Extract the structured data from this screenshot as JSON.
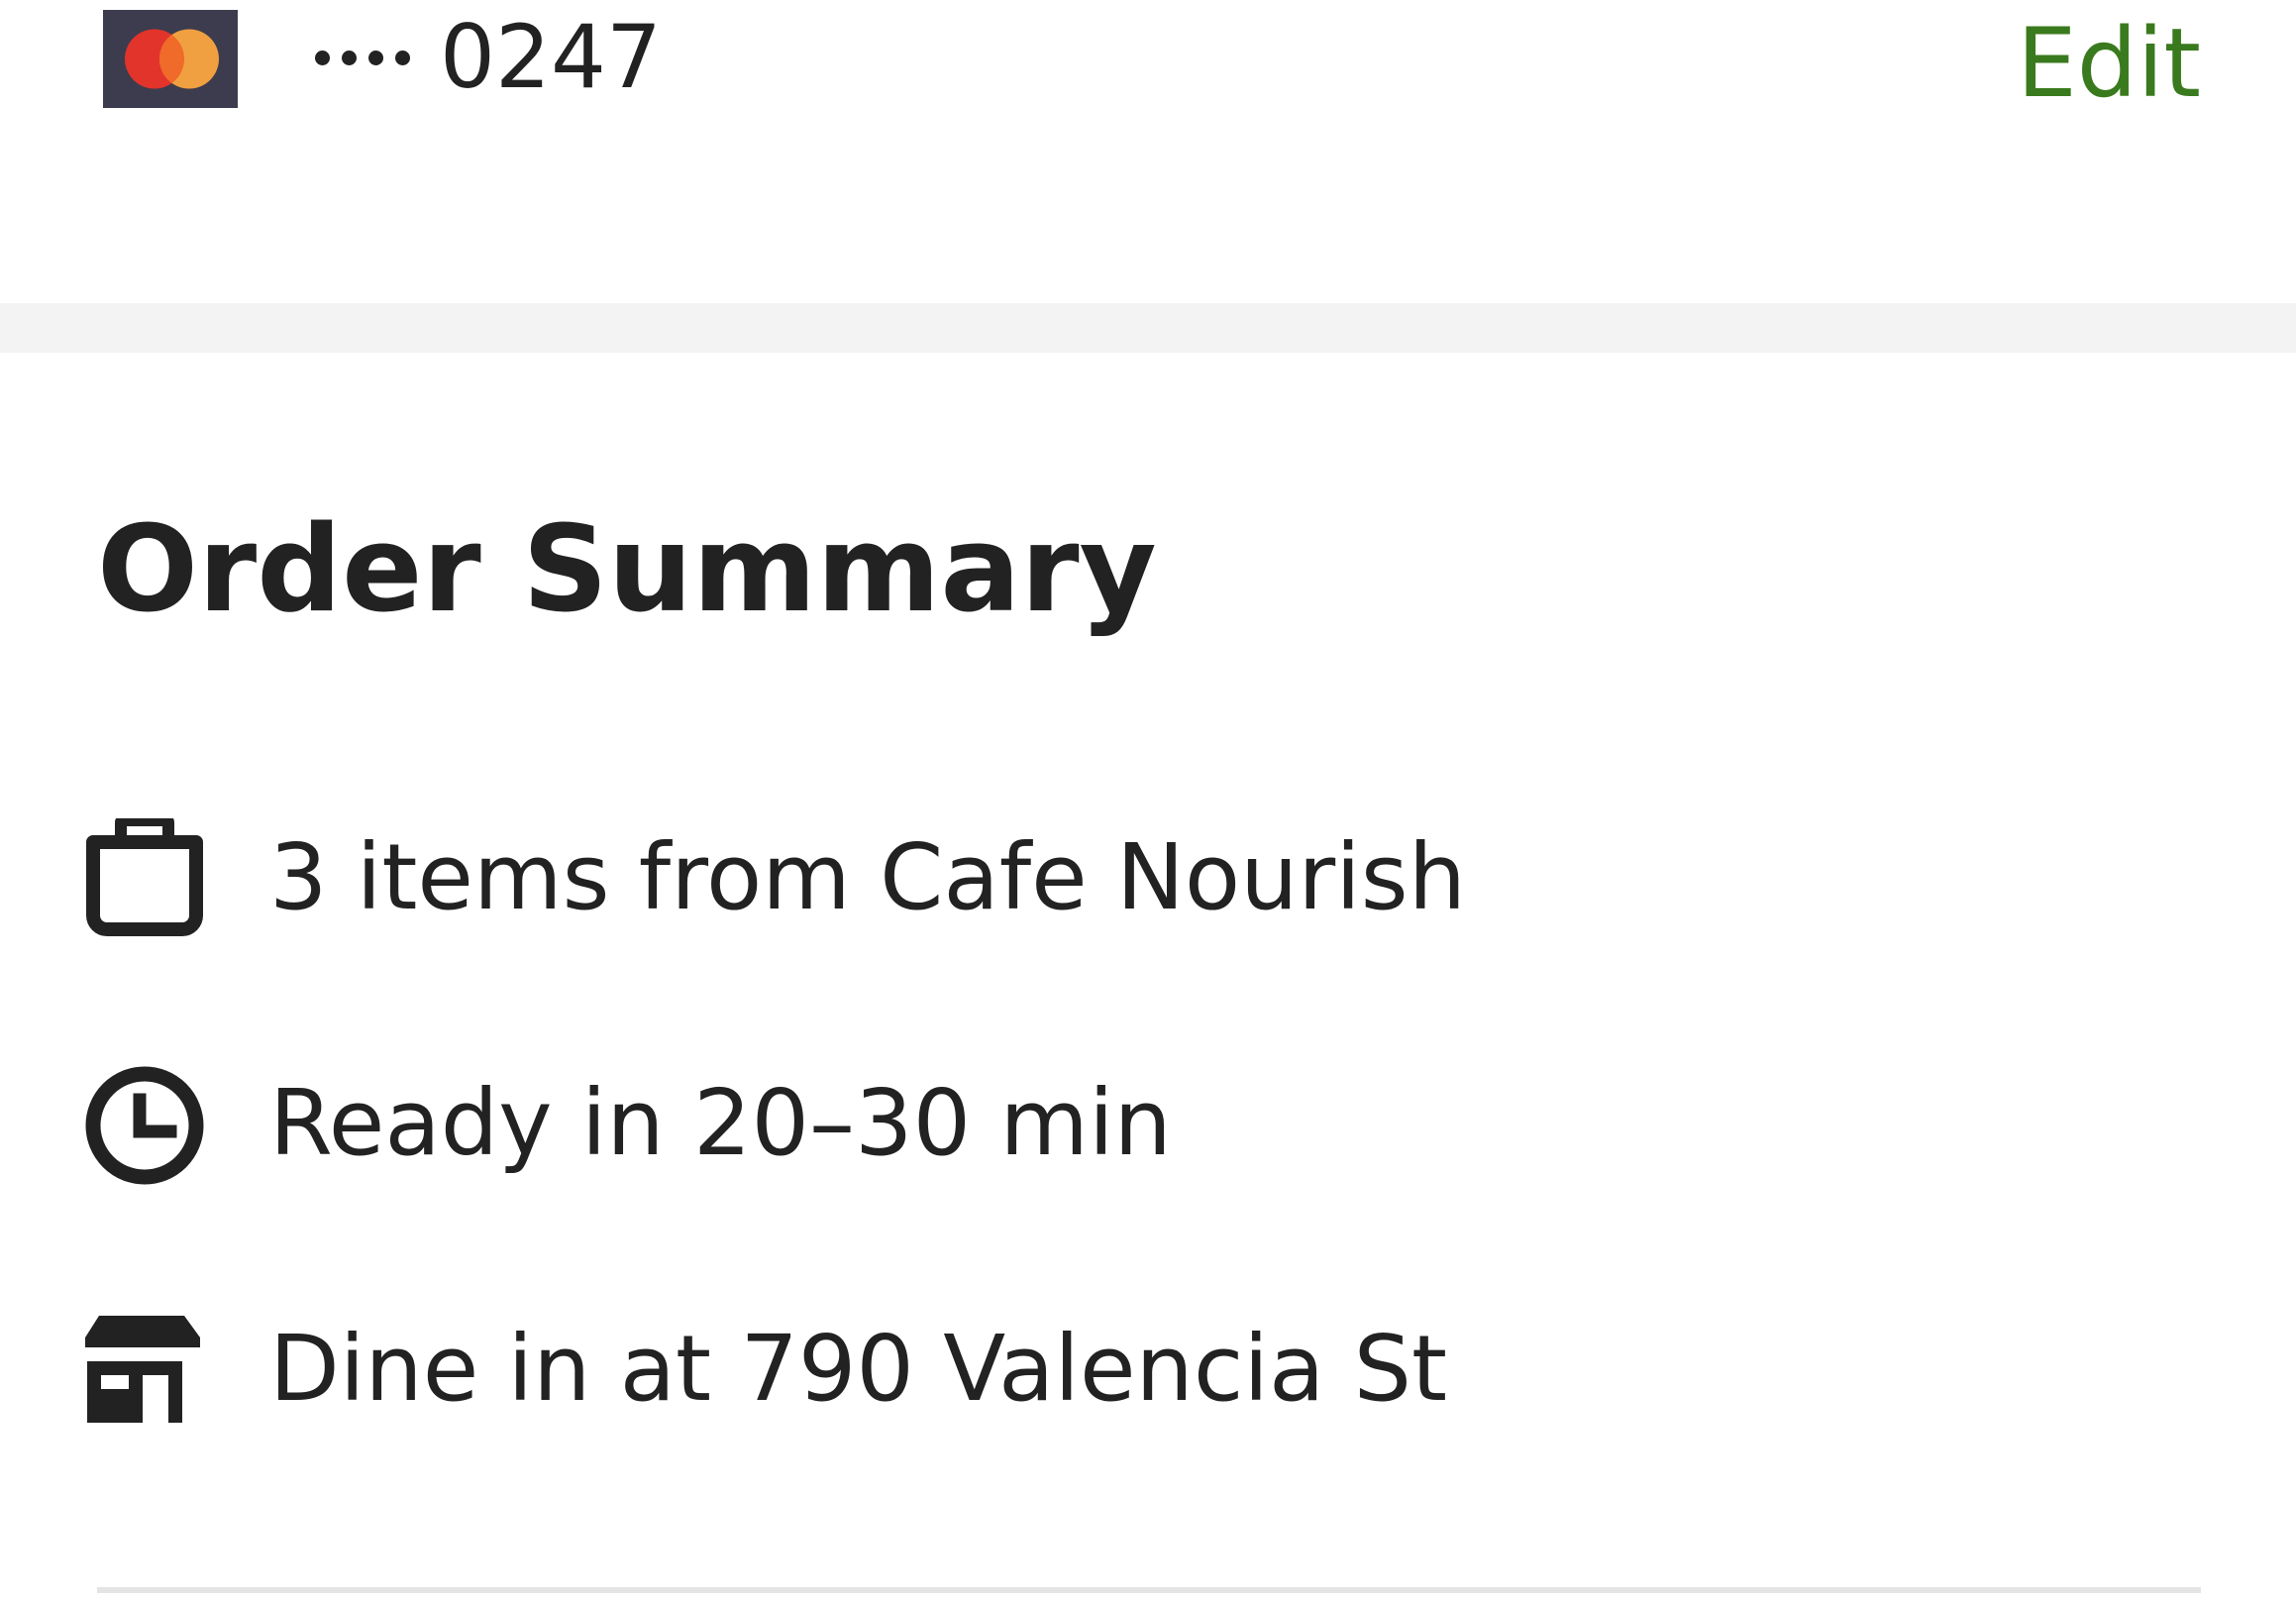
{
  "payment": {
    "card_icon": "mastercard-logo",
    "masked_prefix": "••••",
    "last_four": "0247",
    "edit_label": "Edit"
  },
  "order_summary": {
    "title": "Order Summary",
    "items": [
      {
        "icon": "shopping-bag-icon",
        "text": "3 items from Cafe Nourish"
      },
      {
        "icon": "clock-icon",
        "text": "Ready in 20–30 min"
      },
      {
        "icon": "storefront-icon",
        "text": "Dine in at 790 Valencia St"
      }
    ]
  },
  "colors": {
    "accent": "#3a7a1e",
    "text": "#222222",
    "card_bg": "#3d3c4e",
    "mastercard_red": "#e2342b",
    "mastercard_orange": "#f0a040",
    "band": "#f3f3f3"
  }
}
